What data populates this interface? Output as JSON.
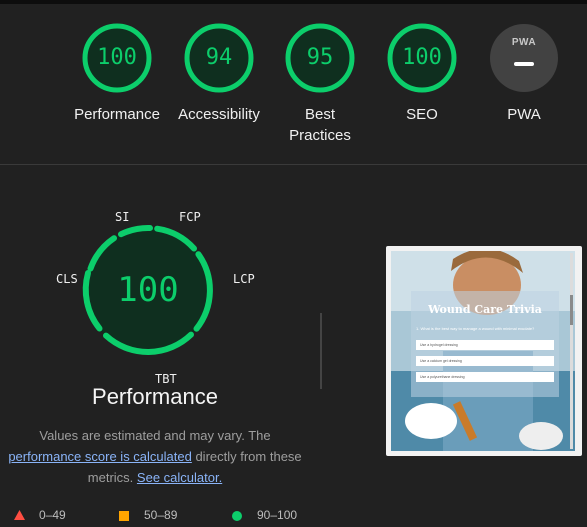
{
  "categories": [
    {
      "label": "Performance",
      "score": "100",
      "fraction": 1.0
    },
    {
      "label": "Accessibility",
      "score": "94",
      "fraction": 0.94
    },
    {
      "label": "Best Practices",
      "score": "95",
      "fraction": 0.95
    },
    {
      "label": "SEO",
      "score": "100",
      "fraction": 1.0
    }
  ],
  "pwa": {
    "label": "PWA",
    "badge_text": "PWA"
  },
  "performance": {
    "score": "100",
    "title": "Performance",
    "metrics": [
      "SI",
      "FCP",
      "LCP",
      "TBT",
      "CLS"
    ],
    "desc_before": "Values are estimated and may vary. The ",
    "desc_link": "performance score is calculated",
    "desc_middle": " directly from these metrics. ",
    "desc_calc": "See calculator."
  },
  "thumbnail": {
    "title": "Wound Care Trivia",
    "question": "1. What is the best way to manage a wound with minimal exudate?",
    "options": [
      "Use a hydrogel dressing",
      "Use a calcium gel dressing",
      "Use a polyurethane dressing"
    ]
  },
  "legend": [
    {
      "range": "0–49",
      "shape": "triangle",
      "color": "#ff4e42"
    },
    {
      "range": "50–89",
      "shape": "square",
      "color": "#ffa400"
    },
    {
      "range": "90–100",
      "shape": "circle",
      "color": "#0cce6b"
    }
  ],
  "colors": {
    "pass": "#0cce6b",
    "pass_bg": "#0f2f1f",
    "background": "#212121"
  }
}
